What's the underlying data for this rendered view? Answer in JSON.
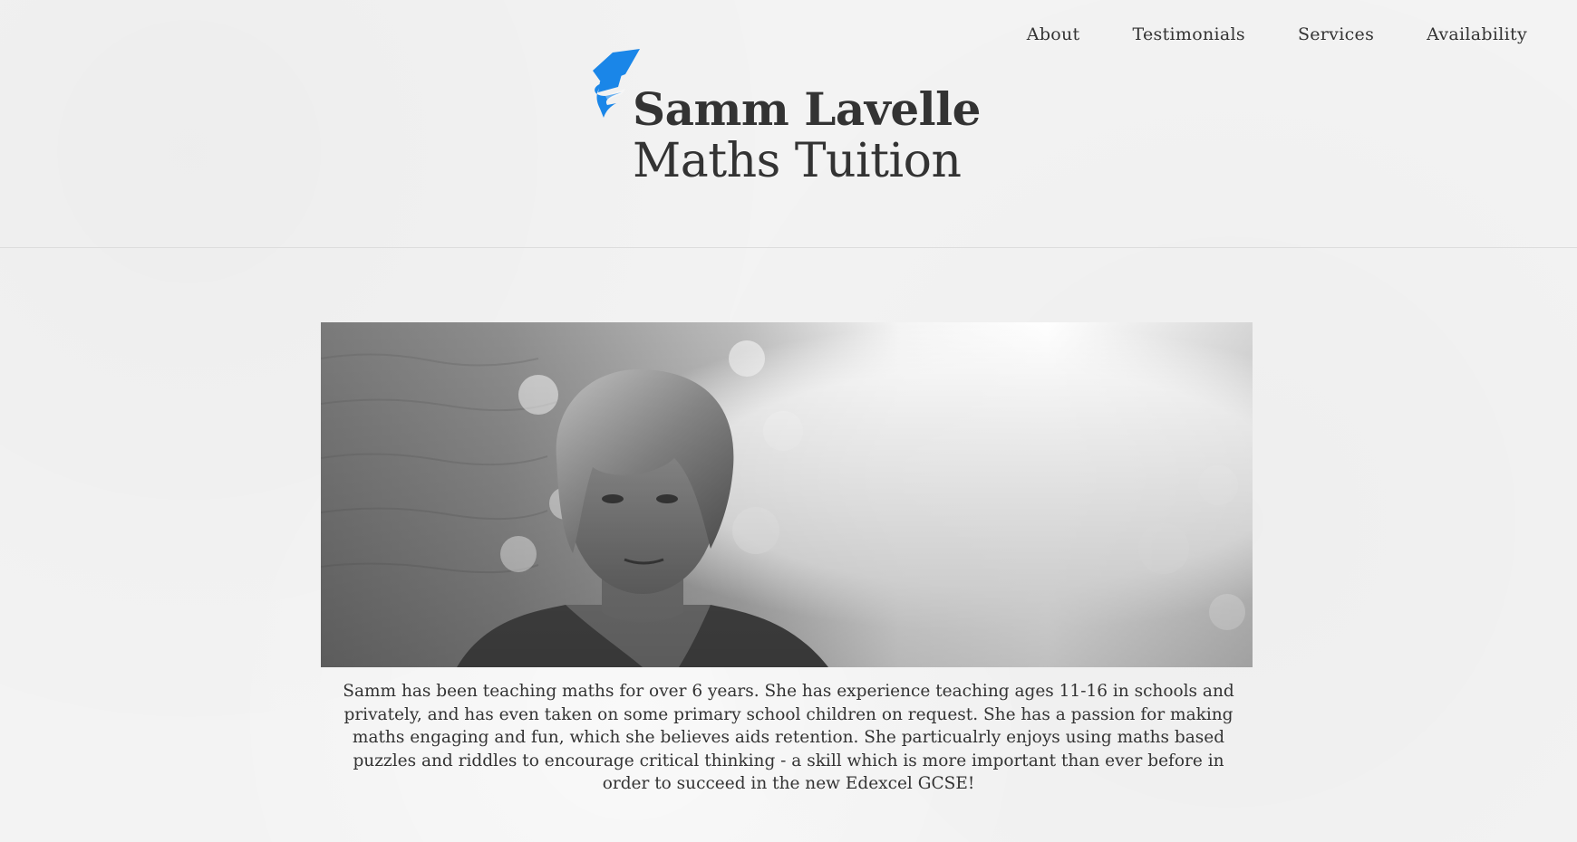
{
  "nav": {
    "items": [
      {
        "label": "About"
      },
      {
        "label": "Testimonials"
      },
      {
        "label": "Services"
      },
      {
        "label": "Availability"
      }
    ]
  },
  "logo": {
    "title": "Samm Lavelle",
    "subtitle": "Maths Tuition",
    "icon": "graduation-cap-icon",
    "icon_color": "#1a86e8"
  },
  "hero": {
    "image": "portrait-photo"
  },
  "bio": {
    "text": "Samm has been teaching maths for over 6 years. She has experience teaching ages 11-16 in schools and privately, and has even taken on some primary school children on request. She has a passion for making maths engaging and fun, which she believes aids retention. She particualrly enjoys using maths based puzzles and riddles to encourage critical thinking - a skill which is more important than ever before in order to succeed in the new Edexcel GCSE!"
  },
  "colors": {
    "background": "#f3f3f3",
    "text": "#333333",
    "accent": "#1a86e8"
  }
}
